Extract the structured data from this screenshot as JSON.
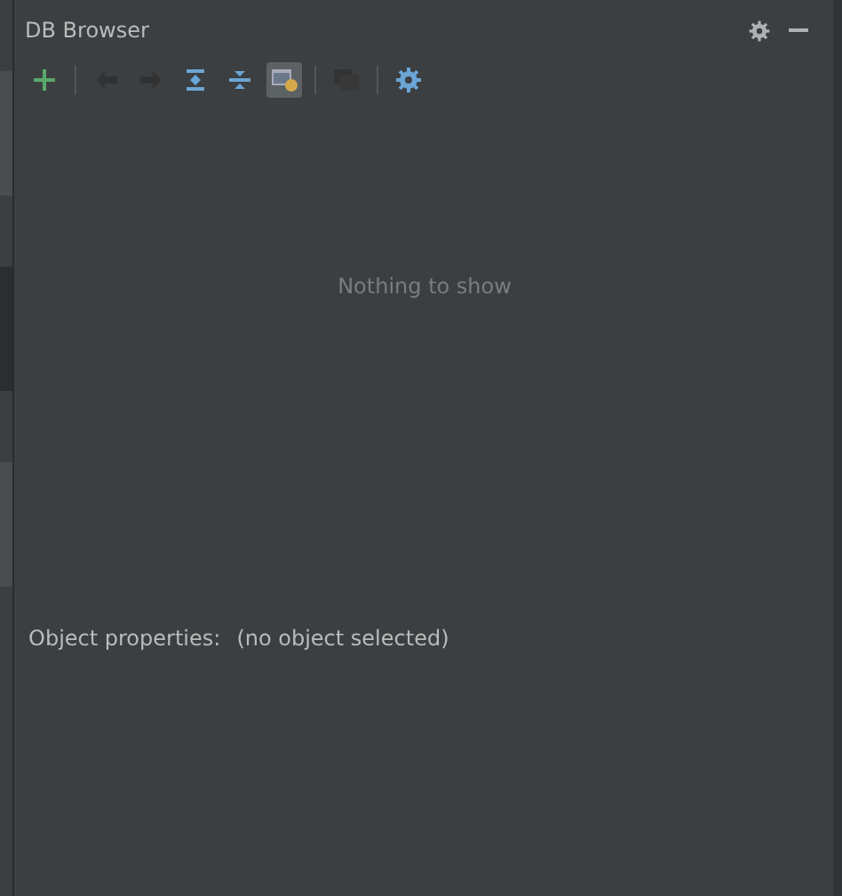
{
  "side_tabs": [
    {
      "selected": false
    },
    {
      "selected": true
    },
    {
      "selected": false
    }
  ],
  "window": {
    "title": "DB Browser"
  },
  "toolbar": [
    {
      "kind": "add",
      "disabled": false,
      "selected": false
    },
    {
      "kind": "separator"
    },
    {
      "kind": "back",
      "disabled": true,
      "selected": false
    },
    {
      "kind": "forward",
      "disabled": true,
      "selected": false
    },
    {
      "kind": "expand",
      "disabled": false,
      "selected": false
    },
    {
      "kind": "collapse",
      "disabled": false,
      "selected": false
    },
    {
      "kind": "toggle",
      "disabled": false,
      "selected": true
    },
    {
      "kind": "separator"
    },
    {
      "kind": "windows",
      "disabled": true,
      "selected": false
    },
    {
      "kind": "separator"
    },
    {
      "kind": "settings",
      "disabled": false,
      "selected": false
    }
  ],
  "tree": {
    "empty_text": "Nothing to show"
  },
  "properties": {
    "label": "Object properties:",
    "value": "(no object selected)"
  }
}
